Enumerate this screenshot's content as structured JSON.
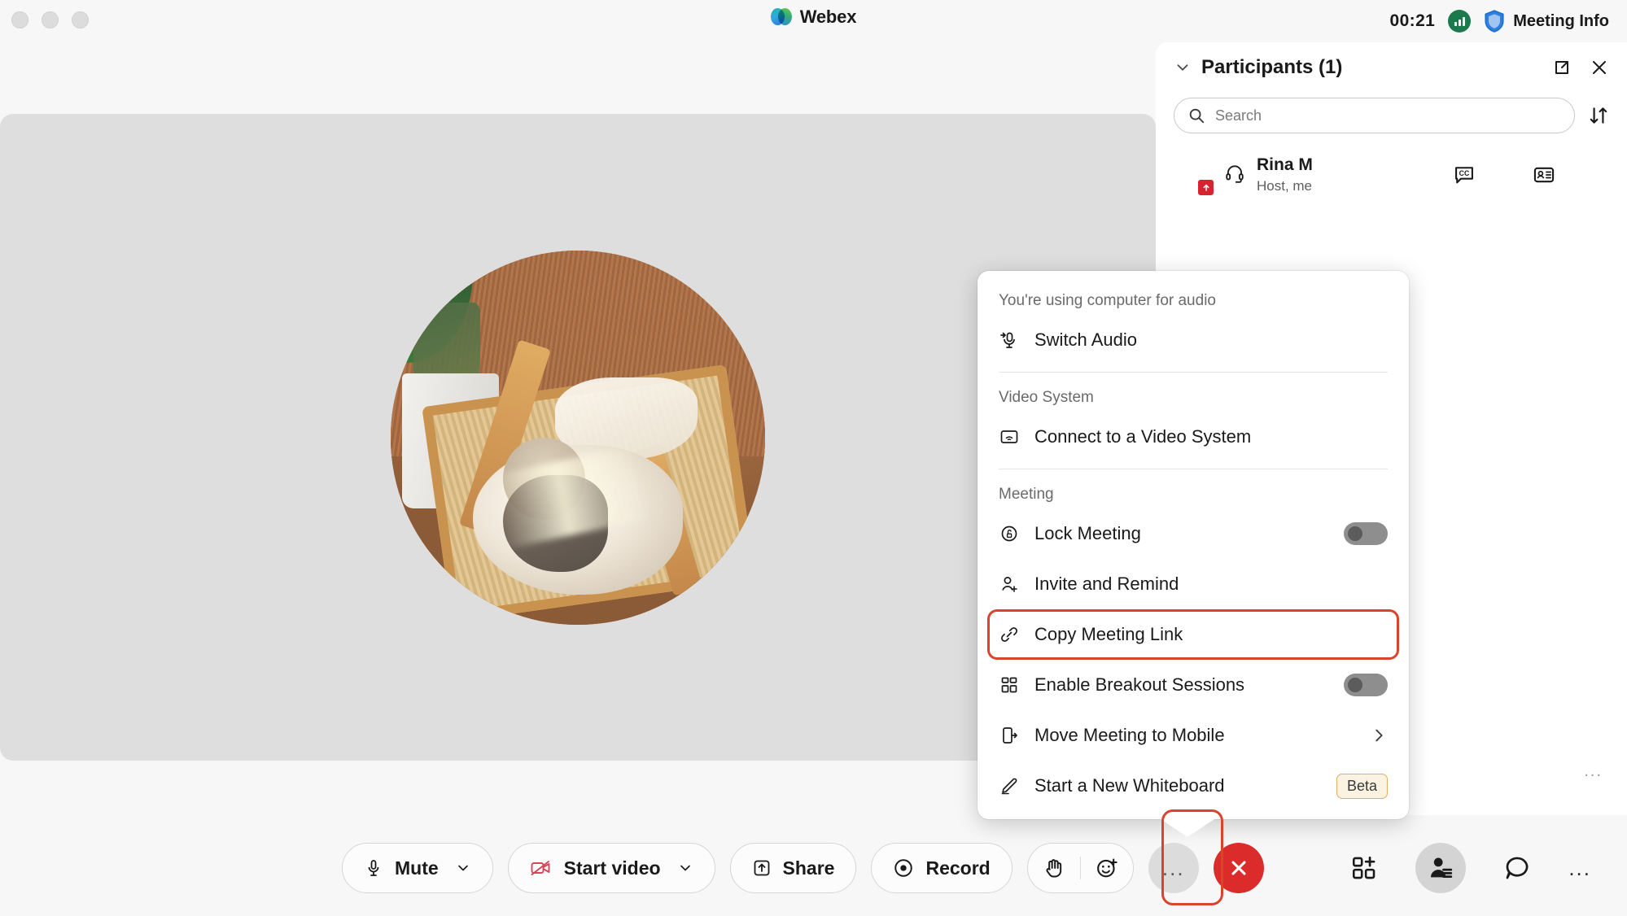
{
  "titlebar": {
    "app_name": "Webex",
    "timer": "00:21",
    "meeting_info_label": "Meeting Info",
    "signal_icon": "signal-strength-icon",
    "shield_icon": "shield-icon",
    "window_controls": [
      "close",
      "minimize",
      "maximize"
    ]
  },
  "stage": {
    "avatar_alt": "sleeping-cats-photo",
    "overflow_label": "..."
  },
  "panel": {
    "title": "Participants (1)",
    "collapse_icon": "chevron-down-icon",
    "popout_icon": "pop-out-icon",
    "close_icon": "close-icon",
    "search": {
      "placeholder": "Search",
      "value": "",
      "icon": "search-icon"
    },
    "sort_icon": "sort-icon",
    "overflow_label": "...",
    "participants": [
      {
        "name": "Rina M",
        "role": "Host, me",
        "audio_icon": "headset-icon",
        "badge_icon": "share-badge-icon",
        "cc_icon": "closed-caption-icon",
        "card_icon": "contact-card-icon"
      }
    ]
  },
  "menu": {
    "sections": [
      {
        "label": "You're using computer for audio",
        "items": [
          {
            "label": "Switch Audio",
            "icon": "switch-audio-icon",
            "control": "none"
          }
        ]
      },
      {
        "label": "Video System",
        "items": [
          {
            "label": "Connect to a Video System",
            "icon": "video-system-icon",
            "control": "none"
          }
        ]
      },
      {
        "label": "Meeting",
        "items": [
          {
            "label": "Lock Meeting",
            "icon": "lock-icon",
            "control": "toggle",
            "toggle_on": false
          },
          {
            "label": "Invite and Remind",
            "icon": "invite-person-icon",
            "control": "none"
          },
          {
            "label": "Copy Meeting Link",
            "icon": "link-icon",
            "control": "none",
            "highlighted": true
          },
          {
            "label": "Enable Breakout Sessions",
            "icon": "breakout-grid-icon",
            "control": "toggle",
            "toggle_on": false
          },
          {
            "label": "Move Meeting to Mobile",
            "icon": "mobile-icon",
            "control": "submenu"
          },
          {
            "label": "Start a New Whiteboard",
            "icon": "pencil-icon",
            "control": "badge",
            "badge": "Beta"
          }
        ]
      }
    ]
  },
  "toolbar": {
    "mute_label": "Mute",
    "mute_icon": "microphone-icon",
    "video_label": "Start video",
    "video_icon": "camera-off-icon",
    "share_label": "Share",
    "share_icon": "share-upload-icon",
    "record_label": "Record",
    "record_icon": "record-circle-icon",
    "hand_icon": "raise-hand-icon",
    "reaction_icon": "emoji-reaction-icon",
    "more_label": "...",
    "more_icon": "more-options-icon",
    "end_icon": "end-meeting-icon",
    "layout_icon": "layout-grid-icon",
    "participants_icon": "participants-icon",
    "chat_icon": "chat-bubble-icon",
    "overflow_icon": "more-horizontal-icon",
    "chevron_icon": "chevron-down-icon"
  },
  "colors": {
    "accent_red": "#d9442b",
    "end_red": "#dc2b2b",
    "badge_red": "#d6232f",
    "signal_green": "#1a7a4c",
    "shield_blue": "#1f6fd0",
    "stage_gray": "#dedede",
    "beta_bg": "#fbf2e2"
  }
}
